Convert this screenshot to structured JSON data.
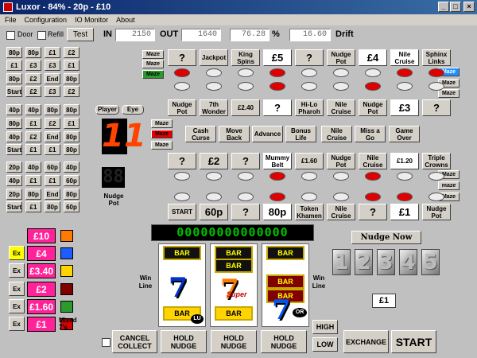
{
  "window": {
    "title": "Luxor - 84% - 20p - £10"
  },
  "menu": [
    "File",
    "Configuration",
    "IO Monitor",
    "About"
  ],
  "toolbar": {
    "door": "Door",
    "refill": "Refill",
    "test": "Test",
    "in_label": "IN",
    "in_value": "2150",
    "out_label": "OUT",
    "out_value": "1640",
    "percent_value": "76.28",
    "percent_sign": "%",
    "drift_value": "16.60",
    "drift_label": "Drift"
  },
  "left_grid": [
    [
      "80p",
      "80p",
      "£1",
      "£2"
    ],
    [
      "£1",
      "£3",
      "£3",
      "£1"
    ],
    [
      "80p",
      "£2",
      "End",
      "80p"
    ],
    [
      "Start",
      "£2",
      "£3",
      "£2"
    ],
    [
      "40p",
      "40p",
      "80p",
      "80p"
    ],
    [
      "80p",
      "£1",
      "£2",
      "£1"
    ],
    [
      "40p",
      "£2",
      "End",
      "80p"
    ],
    [
      "Start",
      "£1",
      "£1",
      "80p"
    ],
    [
      "20p",
      "40p",
      "60p",
      "40p"
    ],
    [
      "40p",
      "£1",
      "£1",
      "60p"
    ],
    [
      "20p",
      "80p",
      "End",
      "80p"
    ],
    [
      "Start",
      "£1",
      "80p",
      "60p"
    ]
  ],
  "player_btn": "Player",
  "eye_btn": "Eye",
  "big_number": "11",
  "nudge_pot_display": "88",
  "nudge_pot_label": "Nudge Pot",
  "prices": [
    {
      "label": "£10",
      "ex": ""
    },
    {
      "label": "£4",
      "ex": "Ex"
    },
    {
      "label": "£3.40",
      "ex": "Ex"
    },
    {
      "label": "£2",
      "ex": "Ex"
    },
    {
      "label": "£1.60",
      "ex": "Ex"
    },
    {
      "label": "£1",
      "ex": "Ex"
    }
  ],
  "mixed_label": "Mixed 7's",
  "maze_label": "Maze",
  "maze_lower": "maze",
  "row1": [
    "?",
    "Jackpot",
    "King Spins",
    "£5",
    "?",
    "Nudge Pot",
    "£4",
    "Nile Cruise",
    "Sphinx Links"
  ],
  "row2": [
    "Nudge Pot",
    "7th Wonder",
    "£2.40",
    "?",
    "Hi-Lo Pharoh",
    "Nile Cruise",
    "Nudge Pot",
    "£3",
    "?"
  ],
  "row3": [
    "Cash Curse",
    "Move Back",
    "Advance",
    "Bonus Life",
    "Nile Cruise",
    "Miss a Go",
    "Game Over"
  ],
  "row4": [
    "?",
    "£2",
    "?",
    "Mummy Belt",
    "£1.60",
    "Nudge Pot",
    "Nile Cruise",
    "£1.20",
    "Triple Crowns"
  ],
  "row5": [
    "START",
    "60p",
    "?",
    "80p",
    "Token Khamen",
    "Nile Cruise",
    "?",
    "£1",
    "Nudge Pot"
  ],
  "led_text": "00000000000000",
  "reels": {
    "win_line": "Win Line",
    "bar": "BAR",
    "super": "Super",
    "lu": "LU",
    "or": "OR"
  },
  "nudge_now": "Nudge Now",
  "nudge_digits": [
    "1",
    "2",
    "3",
    "4",
    "5"
  ],
  "nudge_value": "£1",
  "buttons": {
    "cancel_collect": "CANCEL COLLECT",
    "hold1": "HOLD NUDGE",
    "hold2": "HOLD NUDGE",
    "hold3": "HOLD NUDGE",
    "high": "HIGH",
    "low": "LOW",
    "exchange": "EXCHANGE",
    "start": "START"
  },
  "colors": {
    "title_bar": "#0a246a",
    "lamp_on": "#e00000",
    "price_bg": "#ff2299",
    "led_green": "#00c000",
    "highlight_maze": "#1e90ff"
  }
}
